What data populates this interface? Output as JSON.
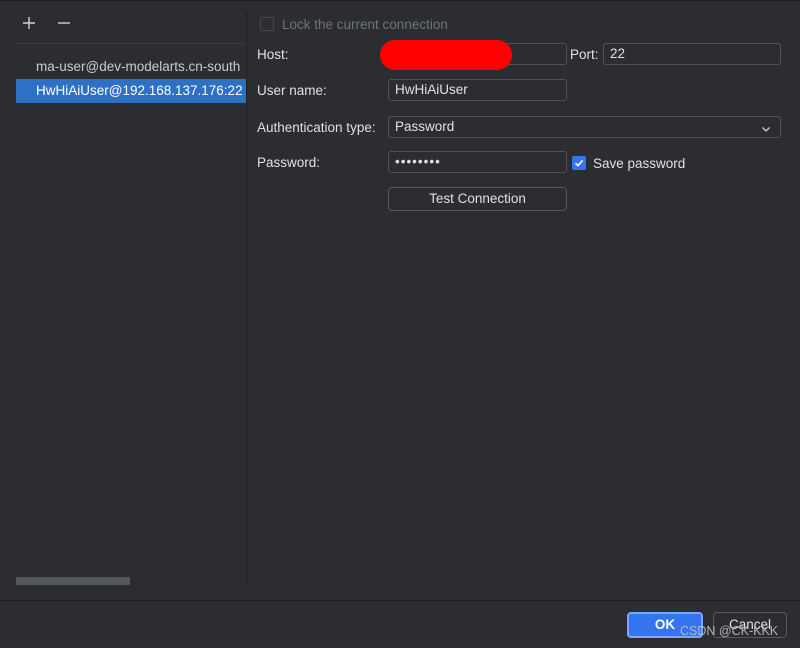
{
  "toolbar": {
    "add_icon": "plus-icon",
    "remove_icon": "minus-icon"
  },
  "connections": [
    {
      "label": "ma-user@dev-modelarts.cn-south",
      "selected": false
    },
    {
      "label": "HwHiAiUser@192.168.137.176:22",
      "selected": true
    }
  ],
  "form": {
    "lock_label": "Lock the current connection",
    "host_label": "Host:",
    "host_value": "",
    "port_label": "Port:",
    "port_value": "22",
    "username_label": "User name:",
    "username_value": "HwHiAiUser",
    "auth_label": "Authentication type:",
    "auth_value": "Password",
    "password_label": "Password:",
    "password_value": "••••••••",
    "save_password_label": "Save password",
    "save_password_checked": true,
    "test_button": "Test Connection"
  },
  "footer": {
    "ok": "OK",
    "cancel": "Cancel",
    "watermark": "CSDN @CK-KKK"
  },
  "colors": {
    "accent": "#3574f0",
    "selection": "#2e70c4",
    "redaction": "#ff0000"
  }
}
